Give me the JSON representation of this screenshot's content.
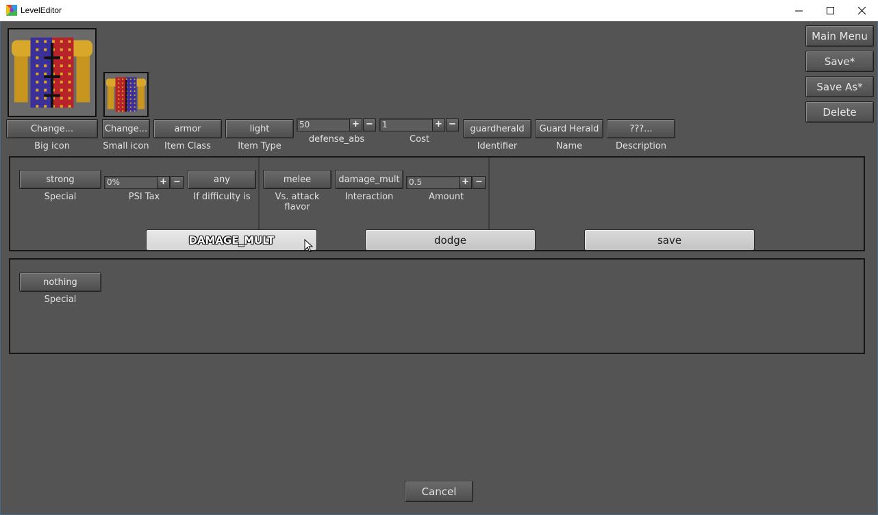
{
  "window": {
    "title": "LevelEditor",
    "minimize_icon": "minimize-icon",
    "maximize_icon": "maximize-icon",
    "close_icon": "close-icon"
  },
  "side_buttons": {
    "main_menu": "Main Menu",
    "save": "Save*",
    "save_as": "Save As*",
    "delete": "Delete"
  },
  "item_row": {
    "big_icon": {
      "button": "Change...",
      "label": "Big icon"
    },
    "small_icon": {
      "button": "Change...",
      "label": "Small icon"
    },
    "item_class": {
      "button": "armor",
      "label": "Item Class"
    },
    "item_type": {
      "button": "light",
      "label": "Item Type"
    },
    "defense_abs": {
      "value": "50",
      "label": "defense_abs"
    },
    "cost": {
      "value": "1",
      "label": "Cost"
    },
    "identifier": {
      "button": "guardherald",
      "label": "Identifier"
    },
    "name": {
      "button": "Guard Herald",
      "label": "Name"
    },
    "description": {
      "button": "???...",
      "label": "Description"
    }
  },
  "stepper": {
    "plus": "+",
    "minus": "−"
  },
  "effect_panel": {
    "special": {
      "button": "strong",
      "label": "Special"
    },
    "psi_tax": {
      "value": "0%",
      "label": "PSI Tax"
    },
    "difficulty": {
      "button": "any",
      "label": "If difficulty is"
    },
    "attack_flavor": {
      "button": "melee",
      "label_line1": "Vs. attack",
      "label_line2": "flavor"
    },
    "interaction": {
      "button": "damage_mult",
      "label": "Interaction"
    },
    "amount": {
      "value": "0.5",
      "label": "Amount"
    },
    "tabs": [
      "DAMAGE_MULT",
      "dodge",
      "save"
    ]
  },
  "second_panel": {
    "special": {
      "button": "nothing",
      "label": "Special"
    }
  },
  "footer": {
    "cancel": "Cancel"
  },
  "colors": {
    "background": "#545454",
    "button": "#5e5e5e",
    "tab": "#cccccc"
  }
}
